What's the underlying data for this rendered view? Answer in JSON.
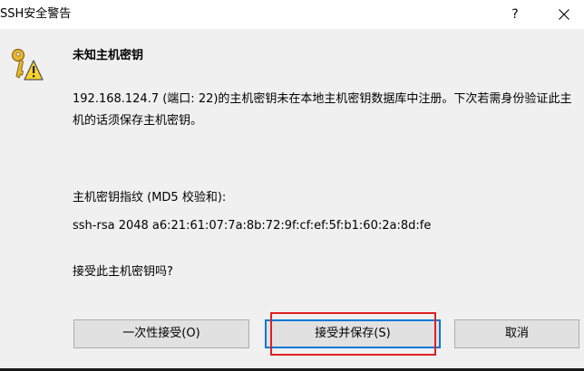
{
  "window": {
    "title": "SSH安全警告",
    "help_label": "?",
    "close_icon": "close-icon"
  },
  "dialog": {
    "icon": "key-warning-icon",
    "heading": "未知主机密钥",
    "message": "192.168.124.7 (端口: 22)的主机密钥未在本地主机密钥数据库中注册。下次若需身份验证此主机的话须保存主机密钥。",
    "fingerprint_label": "主机密钥指纹 (MD5 校验和):",
    "fingerprint_value": "ssh-rsa 2048 a6:21:61:07:7a:8b:72:9f:cf:ef:5f:b1:60:2a:8d:fe",
    "question": "接受此主机密钥吗?"
  },
  "buttons": {
    "accept_once": "一次性接受(O)",
    "accept_save": "接受并保存(S)",
    "cancel": "取消"
  },
  "colors": {
    "focus_border": "#0078d7",
    "highlight": "#e02020",
    "background": "#f0f0f0"
  }
}
